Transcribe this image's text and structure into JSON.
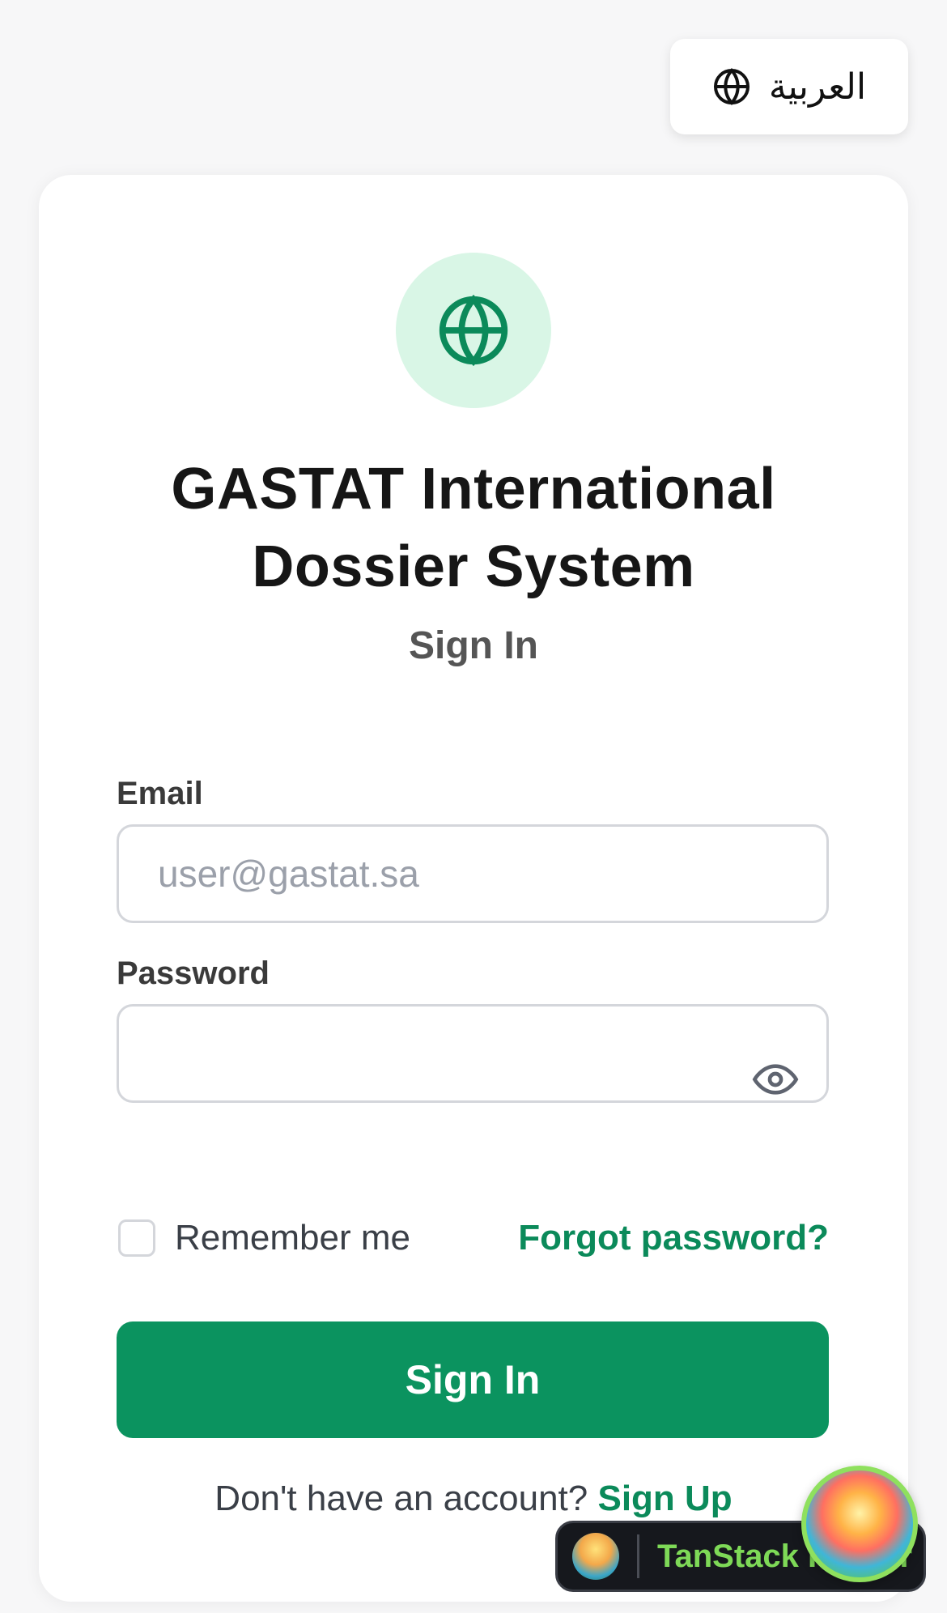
{
  "language_switch": {
    "label": "العربية",
    "icon": "globe-icon"
  },
  "header": {
    "logo_icon": "globe-icon",
    "title_line1": "GASTAT International",
    "title_line2": "Dossier System",
    "subtitle": "Sign In"
  },
  "form": {
    "email_label": "Email",
    "email_placeholder": "user@gastat.sa",
    "email_value": "",
    "password_label": "Password",
    "password_value": "",
    "password_toggle_icon": "eye-icon",
    "remember_label": "Remember me",
    "remember_checked": false,
    "forgot_label": "Forgot password?",
    "submit_label": "Sign In"
  },
  "footer": {
    "prompt": "Don't have an account?",
    "signup_label": "Sign Up"
  },
  "devtools": {
    "label": "TanStack Router"
  },
  "colors": {
    "primary": "#0b935f",
    "link": "#0b8a5a",
    "logo_bg": "#d9f6e6"
  }
}
